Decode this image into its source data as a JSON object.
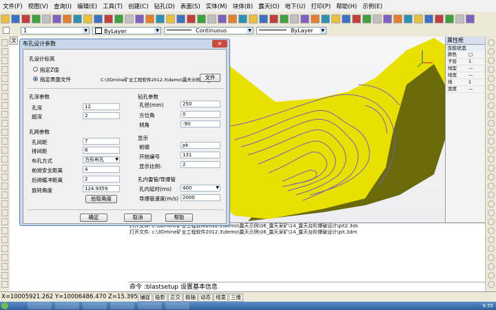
{
  "menu": [
    "文件(F)",
    "视图(V)",
    "查询(I)",
    "编辑(E)",
    "工具(T)",
    "创建(C)",
    "钻孔(D)",
    "表面(S)",
    "实体(M)",
    "块体(B)",
    "露天(O)",
    "地下(U)",
    "打印(P)",
    "帮助(H)",
    "示例(E)"
  ],
  "toolbar2": {
    "layer_value": "1",
    "color_value": "ByLayer",
    "linetype_value": "Continuous",
    "lineweight_value": "ByLayer"
  },
  "doc_tab": "文",
  "props_panel": {
    "title": "属性框",
    "section": "当前状态",
    "rows": [
      {
        "k": "颜色",
        "v": "□"
      },
      {
        "k": "子层",
        "v": "1"
      },
      {
        "k": "线型",
        "v": "—"
      },
      {
        "k": "线宽",
        "v": "—"
      },
      {
        "k": "线",
        "v": "1"
      },
      {
        "k": "宽度",
        "v": "—"
      }
    ]
  },
  "dialog": {
    "title": "布孔设计参数",
    "close_label": "✕",
    "hole_elevation": {
      "label": "孔设计标高",
      "opt_fixed": "指定Z值",
      "opt_surface": "指定表面文件",
      "path": "C:\\3Dmine矿业工程软件2012.3\\demo\\露天示例\\06_露天",
      "file_btn": "文件"
    },
    "depth": {
      "label": "孔深参数",
      "hole_depth_label": "孔深",
      "hole_depth": "12",
      "overdrill_label": "超深",
      "overdrill": "2"
    },
    "mesh": {
      "label": "孔网参数",
      "spacing_label": "孔间距",
      "spacing": "7",
      "row_label": "排间距",
      "row": "6",
      "pattern_label": "布孔方式",
      "pattern": "方形布孔",
      "front_label": "前排安全距离",
      "front": "4",
      "back_label": "后排缓冲距离",
      "back": "2",
      "angle_label": "旋转角度",
      "angle": "124.9359",
      "pick_btn": "拾取角度"
    },
    "drill": {
      "label": "钻孔参数",
      "diam_label": "孔径(mm)",
      "diam": "250",
      "azim_label": "方位角",
      "azim": "0",
      "incl_label": "倾角",
      "incl": "-90"
    },
    "display": {
      "label": "显示",
      "prefix_label": "前缀",
      "prefix": "pk",
      "start_label": "开始编号",
      "start": "131",
      "scale_label": "显示比例:",
      "scale": "2"
    },
    "pipe": {
      "label": "孔内雷管/导爆管",
      "delay_label": "孔内延时(ms)",
      "delay": "400",
      "speed_label": "导爆管速度(m/s)",
      "speed": "2000"
    },
    "ok": "确定",
    "cancel": "取消",
    "help": "帮助"
  },
  "output_lines": [
    "打开文件: c:\\3Dmine矿业工程软件2012.3\\demo\\露天示例\\06_露天采矿\\14_露天台阶爆破设计\\pit2.3ds",
    "打开文件: c:\\3Dmine矿业工程软件2012.3\\demo\\露天示例\\06_露天采矿\\14_露天台阶爆破设计\\pit.3dm"
  ],
  "command": "命令 :blastsetup    设置基本信息",
  "status": {
    "coords": "X=10005921.262 Y=10006486.470 Z=15.395",
    "buttons": [
      "捕捉",
      "投影",
      "正交",
      "极轴",
      "动态",
      "线宽",
      "三维"
    ]
  },
  "tray": {
    "time": "9:55"
  },
  "colors": {
    "terrain": "#e8e000",
    "contour": "#7a5fb0",
    "dialog_frame": "#c8d8ec"
  }
}
